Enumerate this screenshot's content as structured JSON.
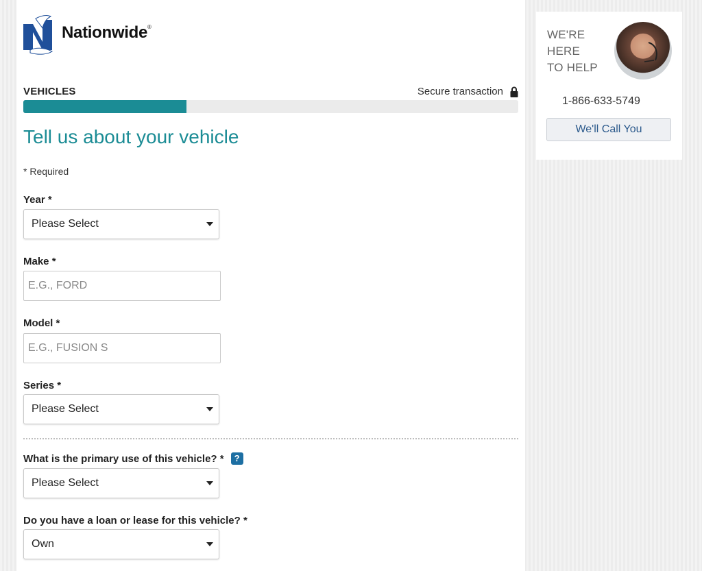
{
  "brand": {
    "name": "Nationwide",
    "registered_mark": "®"
  },
  "progress": {
    "step_label": "VEHICLES",
    "secure_text": "Secure transaction",
    "fraction": 0.33,
    "color": "#1b8c95"
  },
  "form": {
    "title": "Tell us about your vehicle",
    "required_star": "*",
    "required_text": "Required",
    "year": {
      "label": "Year",
      "star": "*",
      "value": "Please Select"
    },
    "make": {
      "label": "Make",
      "star": "*",
      "placeholder": "E.G., FORD"
    },
    "model": {
      "label": "Model",
      "star": "*",
      "placeholder": "E.G., FUSION S"
    },
    "series": {
      "label": "Series",
      "star": "*",
      "value": "Please Select"
    },
    "primary_use": {
      "label": "What is the primary use of this vehicle?",
      "star": "*",
      "help": "?",
      "value": "Please Select"
    },
    "loan_lease": {
      "label": "Do you have a loan or lease for this vehicle?",
      "star": "*",
      "value": "Own"
    }
  },
  "help_panel": {
    "line1": "WE'RE",
    "line2": "HERE",
    "line3": "TO HELP",
    "phone": "1-866-633-5749",
    "call_button": "We'll Call You"
  },
  "icons": [
    "nationwide-eagle-logo",
    "lock-icon",
    "chevron-down-icon",
    "help-icon",
    "agent-avatar"
  ],
  "colors": {
    "teal": "#1b8c95",
    "logo_blue": "#1f4f9a",
    "link_blue": "#2c5a8c"
  }
}
